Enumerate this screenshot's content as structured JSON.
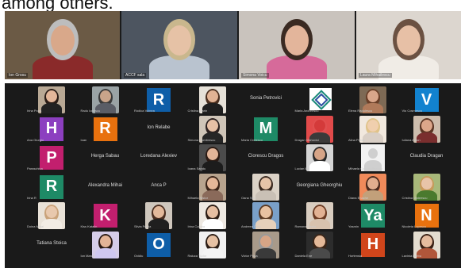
{
  "caption": "among others.",
  "speakers": [
    {
      "name": "Ion Grosu",
      "bg": "#6b5a45",
      "skin": "#d9a88a",
      "shirt": "#8a2a2a",
      "hair": "#bdbdbd"
    },
    {
      "name": "ACCF sala",
      "bg": "#4d5560",
      "skin": "#e6c2a6",
      "shirt": "#b9c3cf",
      "hair": "#c9b78d"
    },
    {
      "name": "Simona Voicu",
      "bg": "#c9c3bd",
      "skin": "#e3b59b",
      "shirt": "#d66a9a",
      "hair": "#3a2a22"
    },
    {
      "name": "Laura Mihailescu",
      "bg": "#dcd6cf",
      "skin": "#e7c0a6",
      "shirt": "#f0ece6",
      "hair": "#6b5142"
    }
  ],
  "participants": [
    {
      "kind": "photo",
      "name": "Irina Popa",
      "skin": "#e4b79a",
      "hair": "#2a1c16",
      "shirt": "#222222",
      "bg": "#b9a995"
    },
    {
      "kind": "photo",
      "name": "Radu Ionescu",
      "skin": "#c9a48a",
      "hair": "#3a3a3a",
      "shirt": "#5a5d66",
      "bg": "#9aa3a5"
    },
    {
      "kind": "letter",
      "letter": "R",
      "color": "#0e5ea8",
      "name": "Rodica Voinea"
    },
    {
      "kind": "photo",
      "name": "Cristina Marin",
      "skin": "#e2b394",
      "hair": "#4a2e1e",
      "shirt": "#1f1f1f",
      "bg": "#e6e1d8"
    },
    {
      "kind": "name",
      "name": "Sonia Petrovici"
    },
    {
      "kind": "logo",
      "name": "Maria Andreescu"
    },
    {
      "kind": "photo",
      "name": "Elena Radulescu",
      "skin": "#d9a68a",
      "hair": "#6a3f28",
      "shirt": "#b07a5a",
      "bg": "#7e6a55"
    },
    {
      "kind": "letter",
      "letter": "V",
      "color": "#1282cf",
      "name": "Vio Cosmescu"
    },
    {
      "kind": "letter",
      "letter": "H",
      "color": "#8c3fc0",
      "name": "Ana Giurgiu"
    },
    {
      "kind": "letter",
      "letter": "R",
      "color": "#e8710e",
      "name": "Ioan"
    },
    {
      "kind": "name",
      "name": "Ion Relabe"
    },
    {
      "kind": "photo",
      "name": "Simona Dumitrescu",
      "skin": "#e6c0a5",
      "hair": "#2c2120",
      "shirt": "#262626",
      "bg": "#cfc5b8"
    },
    {
      "kind": "letter",
      "letter": "M",
      "color": "#1e8a66",
      "name": "Maria Cretescu"
    },
    {
      "kind": "photo",
      "name": "Dragan Vlahovici",
      "skin": "#d43a3a",
      "hair": "#e05050",
      "shirt": "#3a3a3a",
      "bg": "#e14a4a"
    },
    {
      "kind": "photo",
      "name": "Alina Preda",
      "skin": "#f0cfae",
      "hair": "#e0c38a",
      "shirt": "#d9cfc6",
      "bg": "#f1e8de"
    },
    {
      "kind": "photo",
      "name": "Iuliana Anton",
      "skin": "#dca68a",
      "hair": "#5b3524",
      "shirt": "#7a2e2e",
      "bg": "#cdbdad"
    },
    {
      "kind": "letter",
      "letter": "P",
      "color": "#c21f6e",
      "name": "Paraschiva"
    },
    {
      "kind": "name",
      "name": "Herga Sabau"
    },
    {
      "kind": "name",
      "name": "Loredana Alexiev"
    },
    {
      "kind": "photo",
      "name": "Ioana Sandu",
      "skin": "#e3b598",
      "hair": "#2b1b14",
      "shirt": "#1c1c1c",
      "bg": "#4c4c4c"
    },
    {
      "kind": "name",
      "name": "Ciorescu Dragos"
    },
    {
      "kind": "photo",
      "name": "Lucian Ilie",
      "skin": "#d6a487",
      "hair": "#2a2a2a",
      "shirt": "#ffffff",
      "bg": "#d5d5d5"
    },
    {
      "kind": "avatar",
      "name": "Mihaela Constantinescu"
    },
    {
      "kind": "name",
      "name": "Claudia Dragan"
    },
    {
      "kind": "letter",
      "letter": "R",
      "color": "#1e8a66",
      "name": "Irina R"
    },
    {
      "kind": "name",
      "name": "Alexandra Mihai"
    },
    {
      "kind": "name",
      "name": "Anca P"
    },
    {
      "kind": "photo",
      "name": "Mihaela Nistor",
      "skin": "#e4b798",
      "hair": "#3a2418",
      "shirt": "#8a6a5a",
      "bg": "#b8a48e"
    },
    {
      "kind": "photo",
      "name": "Oana Stan",
      "skin": "#e7c4a8",
      "hair": "#3b2a20",
      "shirt": "#c9c0b5",
      "bg": "#dbd2c6"
    },
    {
      "kind": "name",
      "name": "Georgiana Gheorghiu"
    },
    {
      "kind": "photo",
      "name": "Diana Enache",
      "skin": "#e1ad8e",
      "hair": "#4a2a1e",
      "shirt": "#c2a07a",
      "bg": "#f08a5a"
    },
    {
      "kind": "photo",
      "name": "Cristina Mateescu",
      "skin": "#e8c4a8",
      "hair": "#c79a5a",
      "shirt": "#4a7a2e",
      "bg": "#a8b87a"
    },
    {
      "kind": "photo",
      "name": "Doina Mihai",
      "skin": "#e8c8ad",
      "hair": "#c9a27a",
      "shirt": "#f2ece4",
      "bg": "#e9e2d8"
    },
    {
      "kind": "letter",
      "letter": "K",
      "color": "#c21f6e",
      "name": "Kiss Katalin"
    },
    {
      "kind": "photo",
      "name": "Silvia Preda",
      "skin": "#e3b99b",
      "hair": "#4b2e20",
      "shirt": "#1f1f1f",
      "bg": "#cfc7bd"
    },
    {
      "kind": "photo",
      "name": "Irina Costea",
      "skin": "#e6bfa2",
      "hair": "#2b1c14",
      "shirt": "#ffffff",
      "bg": "#eee9e2"
    },
    {
      "kind": "photo",
      "name": "Andreea Dinu",
      "skin": "#e8c2a2",
      "hair": "#5a3a24",
      "shirt": "#e6d0ba",
      "bg": "#7aa0c8"
    },
    {
      "kind": "photo",
      "name": "Ramona Vasile",
      "skin": "#e2b294",
      "hair": "#6a3a22",
      "shirt": "#d8c2ae",
      "bg": "#d9cdc0"
    },
    {
      "kind": "letter",
      "letter": "Ya",
      "color": "#1e8a66",
      "name": "Yasmin"
    },
    {
      "kind": "letter",
      "letter": "N",
      "color": "#e8710e",
      "name": "Nicoleta Lupescu"
    },
    {
      "kind": "name",
      "name": "Tatiana Stoica"
    },
    {
      "kind": "photo",
      "name": "Ion Marcu",
      "skin": "#e3b497",
      "hair": "#2a1a14",
      "shirt": "#cfc8f0",
      "bg": "#d5cde8"
    },
    {
      "kind": "letter",
      "letter": "O",
      "color": "#0e5ea8",
      "name": "Ovidiu"
    },
    {
      "kind": "photo",
      "name": "Raluca Tudor",
      "skin": "#e6c1a3",
      "hair": "#2a1c14",
      "shirt": "#f4f4f4",
      "bg": "#f1f1f1"
    },
    {
      "kind": "photo",
      "name": "Victor Popa",
      "skin": "#d7a586",
      "hair": "#9a9a9a",
      "shirt": "#3a3a3a",
      "bg": "#a89a8a"
    },
    {
      "kind": "photo",
      "name": "Daniela Ene",
      "skin": "#e4b999",
      "hair": "#3b2517",
      "shirt": "#4a4a4a",
      "bg": "#2c2c2c"
    },
    {
      "kind": "letter",
      "letter": "H",
      "color": "#d0451b",
      "name": "Hortensia"
    },
    {
      "kind": "photo",
      "name": "Lavinia Barbu",
      "skin": "#e6bc9e",
      "hair": "#3a2014",
      "shirt": "#b0563a",
      "bg": "#e3dccf"
    }
  ]
}
